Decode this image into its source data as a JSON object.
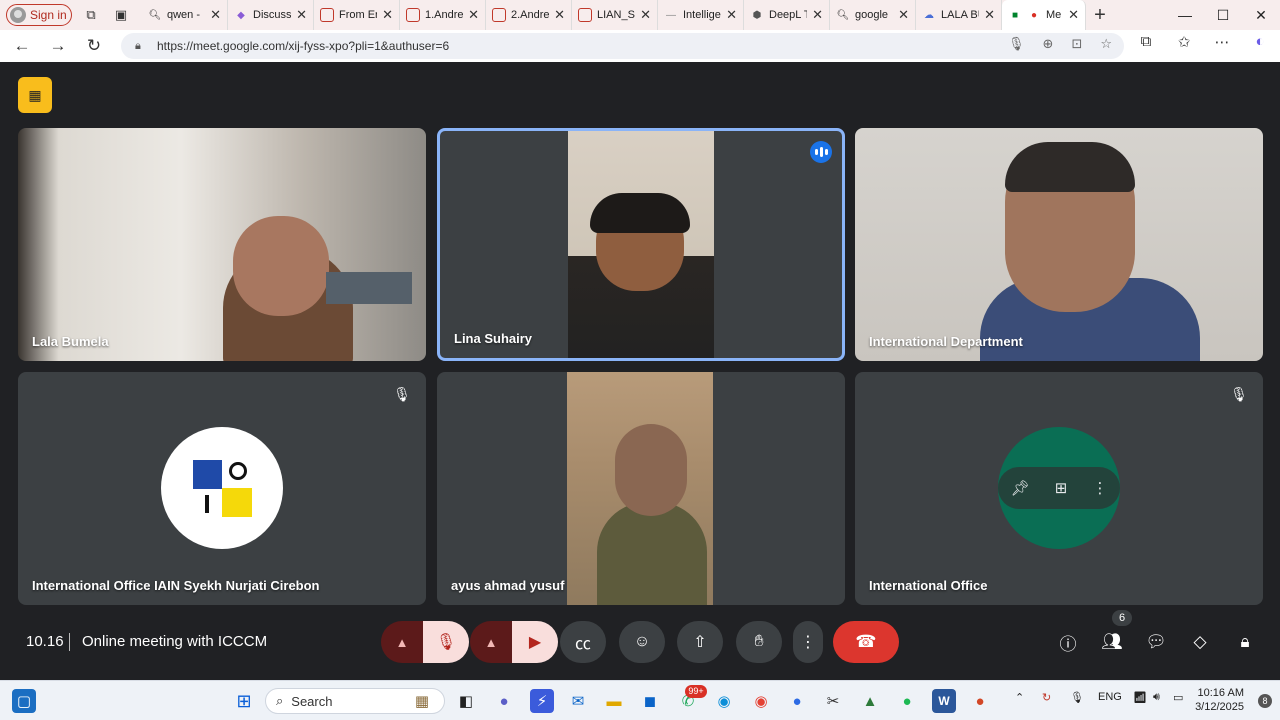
{
  "browser": {
    "signin_label": "Sign in",
    "tabs": [
      {
        "title": "qwen -",
        "icon": "search-icon"
      },
      {
        "title": "Discuss",
        "icon": "discuss-icon"
      },
      {
        "title": "From Er",
        "icon": "pdf-icon"
      },
      {
        "title": "1.Andre",
        "icon": "pdf-icon"
      },
      {
        "title": "2.Andre",
        "icon": "pdf-icon"
      },
      {
        "title": "LIAN_Sy",
        "icon": "pdf-icon"
      },
      {
        "title": "Intellige",
        "icon": "page-icon"
      },
      {
        "title": "DeepL T",
        "icon": "deepl-icon"
      },
      {
        "title": "google",
        "icon": "search-icon"
      },
      {
        "title": "LALA BU",
        "icon": "cloud-icon"
      },
      {
        "title": "Me",
        "icon": "meet-icon",
        "active": true
      }
    ],
    "url": "https://meet.google.com/xij-fyss-xpo?pli=1&authuser=6"
  },
  "meeting": {
    "time": "10.16",
    "title": "Online meeting with ICCCM",
    "participant_count": "6",
    "participants": [
      {
        "name": "Lala Bumela"
      },
      {
        "name": "Lina Suhairy"
      },
      {
        "name": "International Department"
      },
      {
        "name": "International Office IAIN Syekh Nurjati Cirebon"
      },
      {
        "name": "ayus ahmad yusuf"
      },
      {
        "name": "International Office"
      }
    ]
  },
  "taskbar": {
    "search_placeholder": "Search",
    "chat_badge": "99+",
    "lang": "ENG",
    "time": "10:16 AM",
    "date": "3/12/2025",
    "notifications": "8"
  },
  "colors": {
    "accent": "#8ab4f8",
    "end_call": "#dc362e",
    "avatar_green": "#0a6e54"
  }
}
